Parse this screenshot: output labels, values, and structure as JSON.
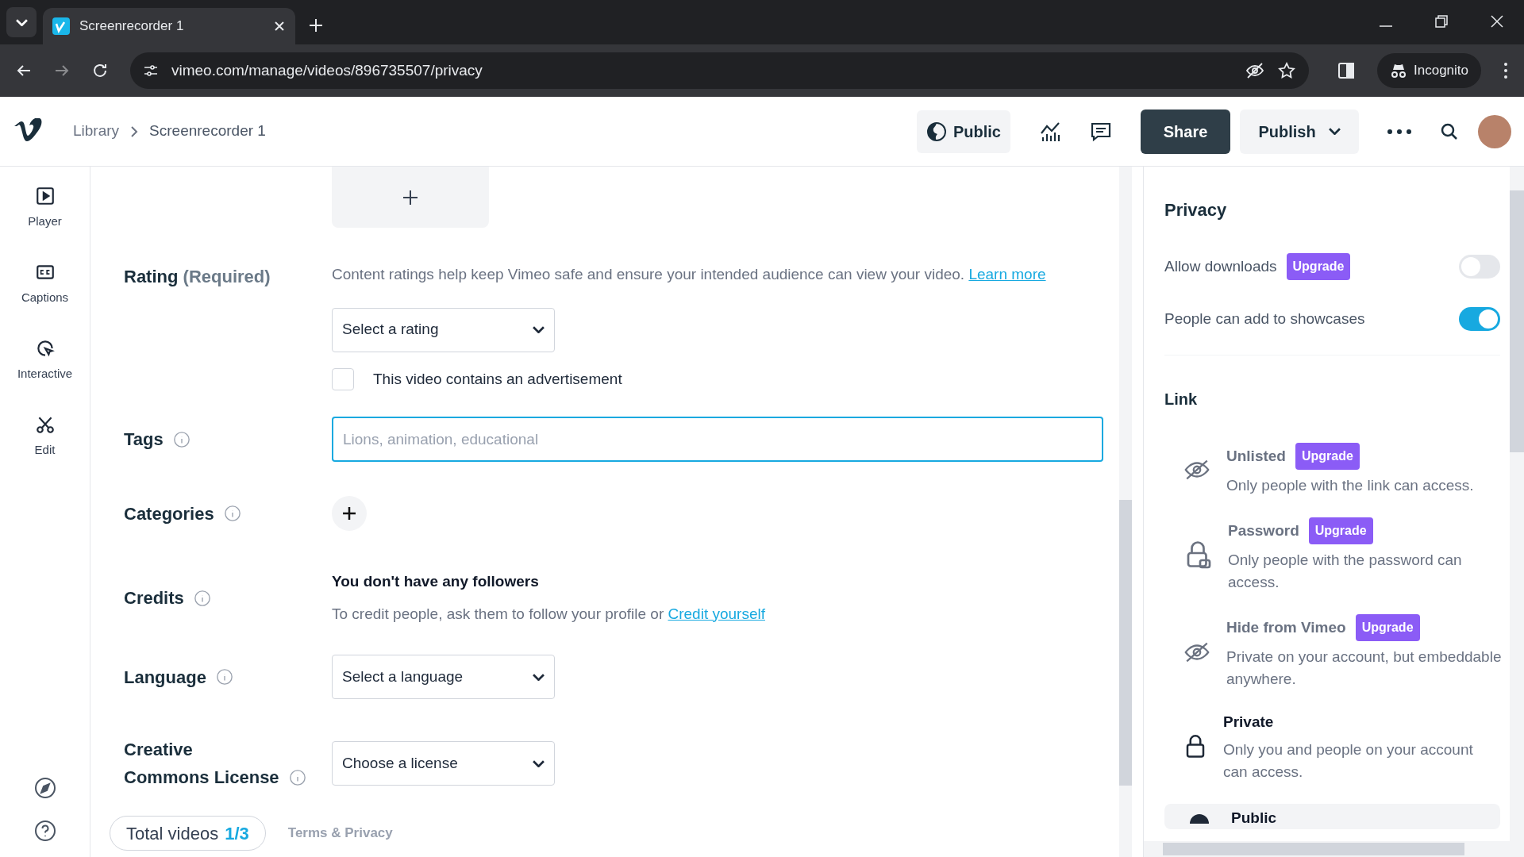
{
  "browser": {
    "tab_title": "Screenrecorder 1",
    "url": "vimeo.com/manage/videos/896735507/privacy",
    "profile": "Incognito"
  },
  "header": {
    "breadcrumb": [
      "Library",
      "Screenrecorder 1"
    ],
    "visibility": "Public",
    "share": "Share",
    "publish": "Publish"
  },
  "sidebar": {
    "items": [
      {
        "kind": "player",
        "label": "Player"
      },
      {
        "kind": "captions",
        "label": "Captions"
      },
      {
        "kind": "interactive",
        "label": "Interactive"
      },
      {
        "kind": "edit",
        "label": "Edit"
      }
    ]
  },
  "form": {
    "rating": {
      "label": "Rating",
      "required": "(Required)",
      "description": "Content ratings help keep Vimeo safe and ensure your intended audience can view your video.",
      "link": "Learn more",
      "select": "Select a rating",
      "ad_checkbox": {
        "label": "This video contains an advertisement",
        "checked": false
      }
    },
    "tags": {
      "label": "Tags",
      "placeholder": "Lions, animation, educational"
    },
    "categories": {
      "label": "Categories"
    },
    "credits": {
      "label": "Credits",
      "title": "You don't have any followers",
      "text": "To credit people, ask them to follow your profile or",
      "link": "Credit yourself"
    },
    "language": {
      "label": "Language",
      "select": "Select a language"
    },
    "license": {
      "label": "Creative Commons License",
      "select": "Choose a license"
    }
  },
  "footer": {
    "total_label": "Total videos",
    "total_count": "1/3",
    "terms": "Terms & Privacy"
  },
  "privacy": {
    "title": "Privacy",
    "toggles": [
      {
        "label": "Allow downloads",
        "badge": "Upgrade",
        "on": false
      },
      {
        "label": "People can add to showcases",
        "on": true
      }
    ],
    "link_title": "Link",
    "options": [
      {
        "kind": "eye-off",
        "title": "Unlisted",
        "badge": "Upgrade",
        "description": "Only people with the link can access.",
        "disabled": true,
        "selected": false
      },
      {
        "kind": "lock-key",
        "title": "Password",
        "badge": "Upgrade",
        "description": "Only people with the password can access.",
        "disabled": true,
        "selected": false
      },
      {
        "kind": "eye-off",
        "title": "Hide from Vimeo",
        "badge": "Upgrade",
        "description": "Private on your account, but embeddable anywhere.",
        "disabled": true,
        "selected": false
      },
      {
        "kind": "lock",
        "title": "Private",
        "description": "Only you and people on your account can access.",
        "disabled": false,
        "selected": false
      },
      {
        "kind": "globe",
        "title": "Public",
        "disabled": false,
        "selected": true
      }
    ]
  }
}
